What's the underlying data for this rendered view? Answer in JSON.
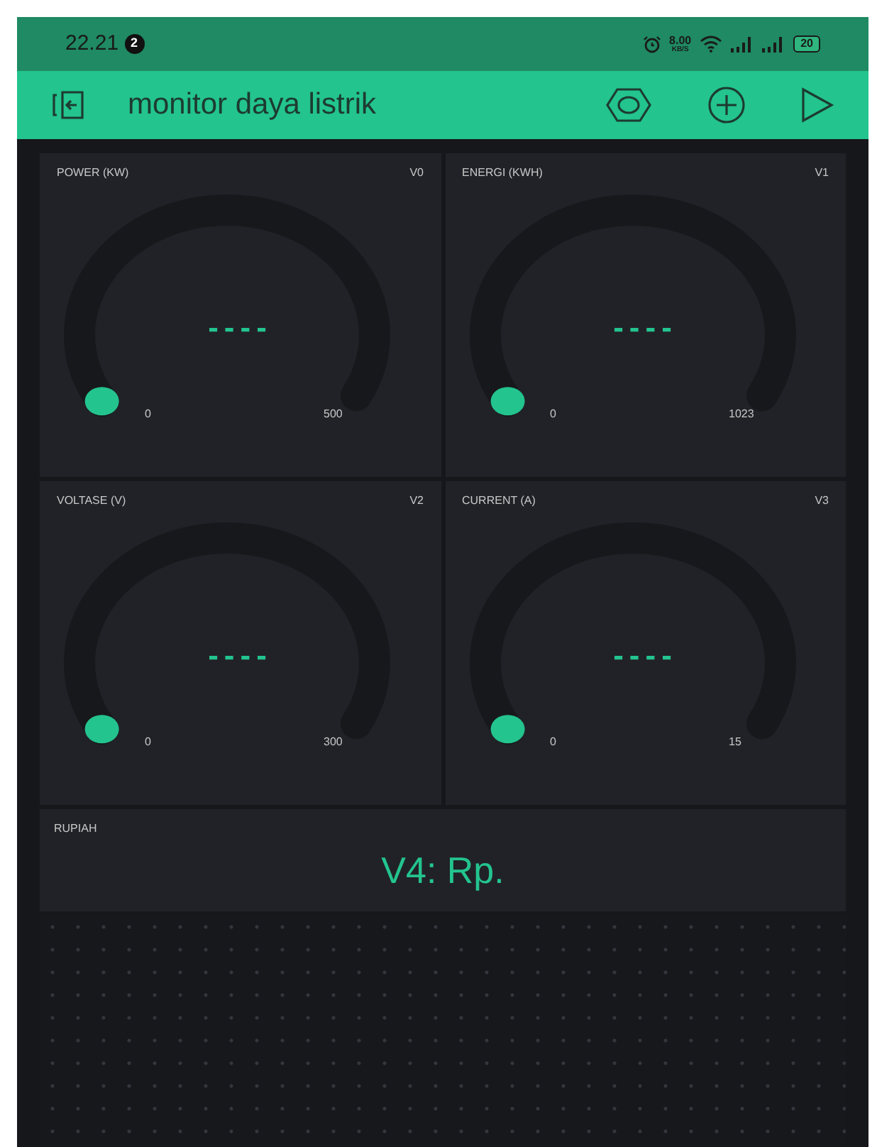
{
  "status_bar": {
    "time": "22.21",
    "notification_count": "2",
    "speed_value": "8.00",
    "speed_unit": "KB/S",
    "battery": "20"
  },
  "app_bar": {
    "title": "monitor daya listrik"
  },
  "gauges": [
    {
      "label": "POWER (KW)",
      "pin": "V0",
      "value": "----",
      "min": "0",
      "max": "500"
    },
    {
      "label": "ENERGI (KWH)",
      "pin": "V1",
      "value": "----",
      "min": "0",
      "max": "1023"
    },
    {
      "label": "VOLTASE (V)",
      "pin": "V2",
      "value": "----",
      "min": "0",
      "max": "300"
    },
    {
      "label": "CURRENT (A)",
      "pin": "V3",
      "value": "----",
      "min": "0",
      "max": "15"
    }
  ],
  "display": {
    "label": "RUPIAH",
    "value": "V4: Rp."
  }
}
